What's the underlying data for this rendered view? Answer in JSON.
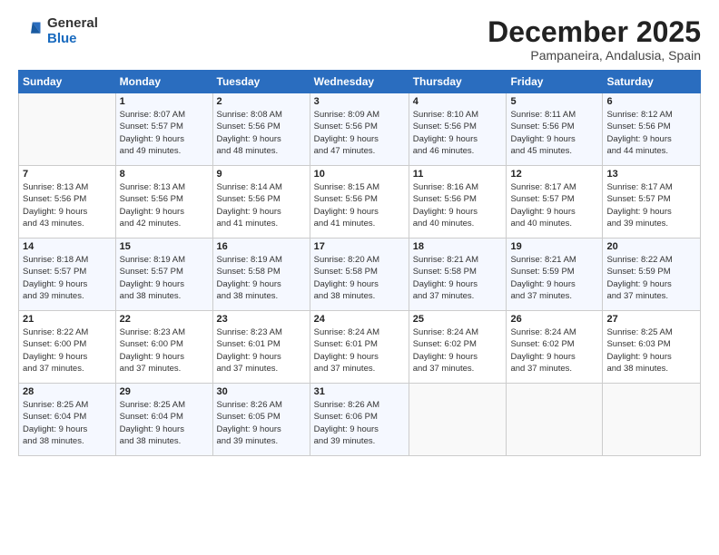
{
  "header": {
    "logo": {
      "general": "General",
      "blue": "Blue"
    },
    "title": "December 2025",
    "subtitle": "Pampaneira, Andalusia, Spain"
  },
  "days_of_week": [
    "Sunday",
    "Monday",
    "Tuesday",
    "Wednesday",
    "Thursday",
    "Friday",
    "Saturday"
  ],
  "weeks": [
    [
      {
        "day": "",
        "info": ""
      },
      {
        "day": "1",
        "info": "Sunrise: 8:07 AM\nSunset: 5:57 PM\nDaylight: 9 hours\nand 49 minutes."
      },
      {
        "day": "2",
        "info": "Sunrise: 8:08 AM\nSunset: 5:56 PM\nDaylight: 9 hours\nand 48 minutes."
      },
      {
        "day": "3",
        "info": "Sunrise: 8:09 AM\nSunset: 5:56 PM\nDaylight: 9 hours\nand 47 minutes."
      },
      {
        "day": "4",
        "info": "Sunrise: 8:10 AM\nSunset: 5:56 PM\nDaylight: 9 hours\nand 46 minutes."
      },
      {
        "day": "5",
        "info": "Sunrise: 8:11 AM\nSunset: 5:56 PM\nDaylight: 9 hours\nand 45 minutes."
      },
      {
        "day": "6",
        "info": "Sunrise: 8:12 AM\nSunset: 5:56 PM\nDaylight: 9 hours\nand 44 minutes."
      }
    ],
    [
      {
        "day": "7",
        "info": "Sunrise: 8:13 AM\nSunset: 5:56 PM\nDaylight: 9 hours\nand 43 minutes."
      },
      {
        "day": "8",
        "info": "Sunrise: 8:13 AM\nSunset: 5:56 PM\nDaylight: 9 hours\nand 42 minutes."
      },
      {
        "day": "9",
        "info": "Sunrise: 8:14 AM\nSunset: 5:56 PM\nDaylight: 9 hours\nand 41 minutes."
      },
      {
        "day": "10",
        "info": "Sunrise: 8:15 AM\nSunset: 5:56 PM\nDaylight: 9 hours\nand 41 minutes."
      },
      {
        "day": "11",
        "info": "Sunrise: 8:16 AM\nSunset: 5:56 PM\nDaylight: 9 hours\nand 40 minutes."
      },
      {
        "day": "12",
        "info": "Sunrise: 8:17 AM\nSunset: 5:57 PM\nDaylight: 9 hours\nand 40 minutes."
      },
      {
        "day": "13",
        "info": "Sunrise: 8:17 AM\nSunset: 5:57 PM\nDaylight: 9 hours\nand 39 minutes."
      }
    ],
    [
      {
        "day": "14",
        "info": "Sunrise: 8:18 AM\nSunset: 5:57 PM\nDaylight: 9 hours\nand 39 minutes."
      },
      {
        "day": "15",
        "info": "Sunrise: 8:19 AM\nSunset: 5:57 PM\nDaylight: 9 hours\nand 38 minutes."
      },
      {
        "day": "16",
        "info": "Sunrise: 8:19 AM\nSunset: 5:58 PM\nDaylight: 9 hours\nand 38 minutes."
      },
      {
        "day": "17",
        "info": "Sunrise: 8:20 AM\nSunset: 5:58 PM\nDaylight: 9 hours\nand 38 minutes."
      },
      {
        "day": "18",
        "info": "Sunrise: 8:21 AM\nSunset: 5:58 PM\nDaylight: 9 hours\nand 37 minutes."
      },
      {
        "day": "19",
        "info": "Sunrise: 8:21 AM\nSunset: 5:59 PM\nDaylight: 9 hours\nand 37 minutes."
      },
      {
        "day": "20",
        "info": "Sunrise: 8:22 AM\nSunset: 5:59 PM\nDaylight: 9 hours\nand 37 minutes."
      }
    ],
    [
      {
        "day": "21",
        "info": "Sunrise: 8:22 AM\nSunset: 6:00 PM\nDaylight: 9 hours\nand 37 minutes."
      },
      {
        "day": "22",
        "info": "Sunrise: 8:23 AM\nSunset: 6:00 PM\nDaylight: 9 hours\nand 37 minutes."
      },
      {
        "day": "23",
        "info": "Sunrise: 8:23 AM\nSunset: 6:01 PM\nDaylight: 9 hours\nand 37 minutes."
      },
      {
        "day": "24",
        "info": "Sunrise: 8:24 AM\nSunset: 6:01 PM\nDaylight: 9 hours\nand 37 minutes."
      },
      {
        "day": "25",
        "info": "Sunrise: 8:24 AM\nSunset: 6:02 PM\nDaylight: 9 hours\nand 37 minutes."
      },
      {
        "day": "26",
        "info": "Sunrise: 8:24 AM\nSunset: 6:02 PM\nDaylight: 9 hours\nand 37 minutes."
      },
      {
        "day": "27",
        "info": "Sunrise: 8:25 AM\nSunset: 6:03 PM\nDaylight: 9 hours\nand 38 minutes."
      }
    ],
    [
      {
        "day": "28",
        "info": "Sunrise: 8:25 AM\nSunset: 6:04 PM\nDaylight: 9 hours\nand 38 minutes."
      },
      {
        "day": "29",
        "info": "Sunrise: 8:25 AM\nSunset: 6:04 PM\nDaylight: 9 hours\nand 38 minutes."
      },
      {
        "day": "30",
        "info": "Sunrise: 8:26 AM\nSunset: 6:05 PM\nDaylight: 9 hours\nand 39 minutes."
      },
      {
        "day": "31",
        "info": "Sunrise: 8:26 AM\nSunset: 6:06 PM\nDaylight: 9 hours\nand 39 minutes."
      },
      {
        "day": "",
        "info": ""
      },
      {
        "day": "",
        "info": ""
      },
      {
        "day": "",
        "info": ""
      }
    ]
  ]
}
